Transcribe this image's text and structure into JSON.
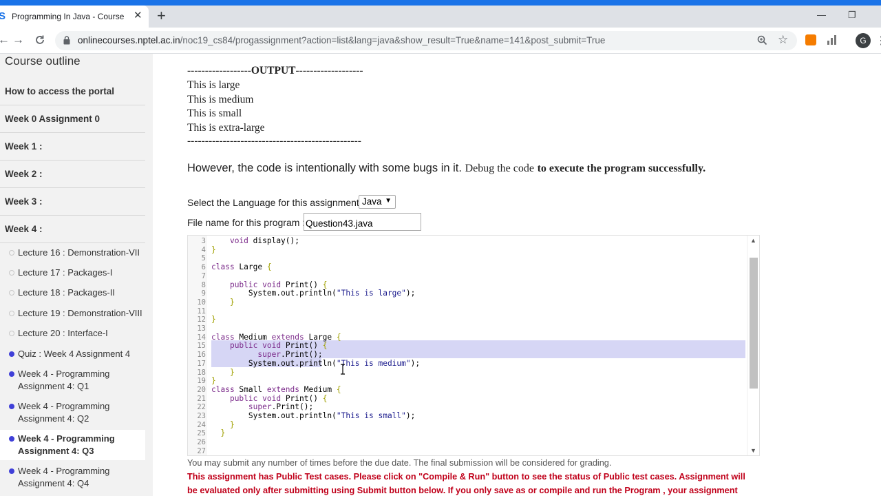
{
  "browser": {
    "tab_title": "Programming In Java - Course",
    "tab_favicon": "S",
    "tab_close": "✕",
    "new_tab": "+",
    "url_host": "onlinecourses.nptel.ac.in",
    "url_path": "/noc19_cs84/progassignment?action=list&lang=java&show_result=True&name=141&post_submit=True",
    "profile_initial": "G",
    "minimize": "—",
    "restore": "❐",
    "accent_color": "#1a73e8"
  },
  "sidebar": {
    "title": "Course outline",
    "weeks": [
      "How to access the portal",
      "Week 0 Assignment 0",
      "Week 1 :",
      "Week 2 :",
      "Week 3 :",
      "Week 4 :"
    ],
    "items": [
      {
        "label": "Lecture 16 : Demonstration-VII",
        "dot": "open"
      },
      {
        "label": "Lecture 17 : Packages-I",
        "dot": "open"
      },
      {
        "label": "Lecture 18 : Packages-II",
        "dot": "open"
      },
      {
        "label": "Lecture 19 : Demonstration-VIII",
        "dot": "open"
      },
      {
        "label": "Lecture 20 : Interface-I",
        "dot": "open"
      },
      {
        "label": "Quiz : Week 4 Assignment 4",
        "dot": "filled"
      },
      {
        "label_1": "Week 4 - Programming",
        "label_2": "Assignment 4: Q1",
        "dot": "filled"
      },
      {
        "label_1": "Week 4 - Programming",
        "label_2": "Assignment 4: Q2",
        "dot": "filled"
      },
      {
        "label_1": "Week 4 - Programming",
        "label_2": "Assignment 4: Q3",
        "dot": "filled",
        "active": true
      },
      {
        "label_1": "Week 4 - Programming",
        "label_2": "Assignment 4: Q4",
        "dot": "filled"
      }
    ]
  },
  "main": {
    "output_dashes_left": "------------------",
    "output_label": "OUTPUT",
    "output_dashes_right": "-------------------",
    "output_lines": [
      "This is large",
      "This is medium",
      "This is small",
      "This is extra-large"
    ],
    "output_footer": "-------------------------------------------------",
    "description_part1": "However, the code is intentionally with some bugs in it.",
    "description_part2": "Debug the code",
    "description_part3": "to execute the program successfully.",
    "language_label": "Select the Language for this assignment.",
    "language_value": "Java",
    "filename_label": "File name for this program :",
    "filename_value": "Question43.java",
    "code_lines": [
      {
        "n": "3",
        "text": "    void display();"
      },
      {
        "n": "4",
        "text": "}"
      },
      {
        "n": "5",
        "text": ""
      },
      {
        "n": "6",
        "text": "class Large {"
      },
      {
        "n": "7",
        "text": ""
      },
      {
        "n": "8",
        "text": "    public void Print() {"
      },
      {
        "n": "9",
        "text": "        System.out.println(\"This is large\");"
      },
      {
        "n": "10",
        "text": "    }"
      },
      {
        "n": "11",
        "text": ""
      },
      {
        "n": "12",
        "text": "}"
      },
      {
        "n": "13",
        "text": ""
      },
      {
        "n": "14",
        "text": "class Medium extends Large {"
      },
      {
        "n": "15",
        "text": "    public void Print() {"
      },
      {
        "n": "16",
        "text": "          super.Print();"
      },
      {
        "n": "17",
        "text": "        System.out.println(\"This is medium\");"
      },
      {
        "n": "18",
        "text": "    }"
      },
      {
        "n": "19",
        "text": "}"
      },
      {
        "n": "20",
        "text": "class Small extends Medium {"
      },
      {
        "n": "21",
        "text": "    public void Print() {"
      },
      {
        "n": "22",
        "text": "        super.Print();"
      },
      {
        "n": "23",
        "text": "        System.out.println(\"This is small\");"
      },
      {
        "n": "24",
        "text": "    }"
      },
      {
        "n": "25",
        "text": "  }"
      },
      {
        "n": "26",
        "text": ""
      },
      {
        "n": "27",
        "text": ""
      }
    ],
    "submit_note": "You may submit any number of times before the due date. The final submission will be considered for grading.",
    "warning_line1": "This assignment has Public Test cases. Please click on \"Compile & Run\" button to see the status of Public test cases. Assignment will",
    "warning_line2": "be evaluated only after submitting using Submit button below. If you only save as or compile and run the Program , your assignment"
  }
}
